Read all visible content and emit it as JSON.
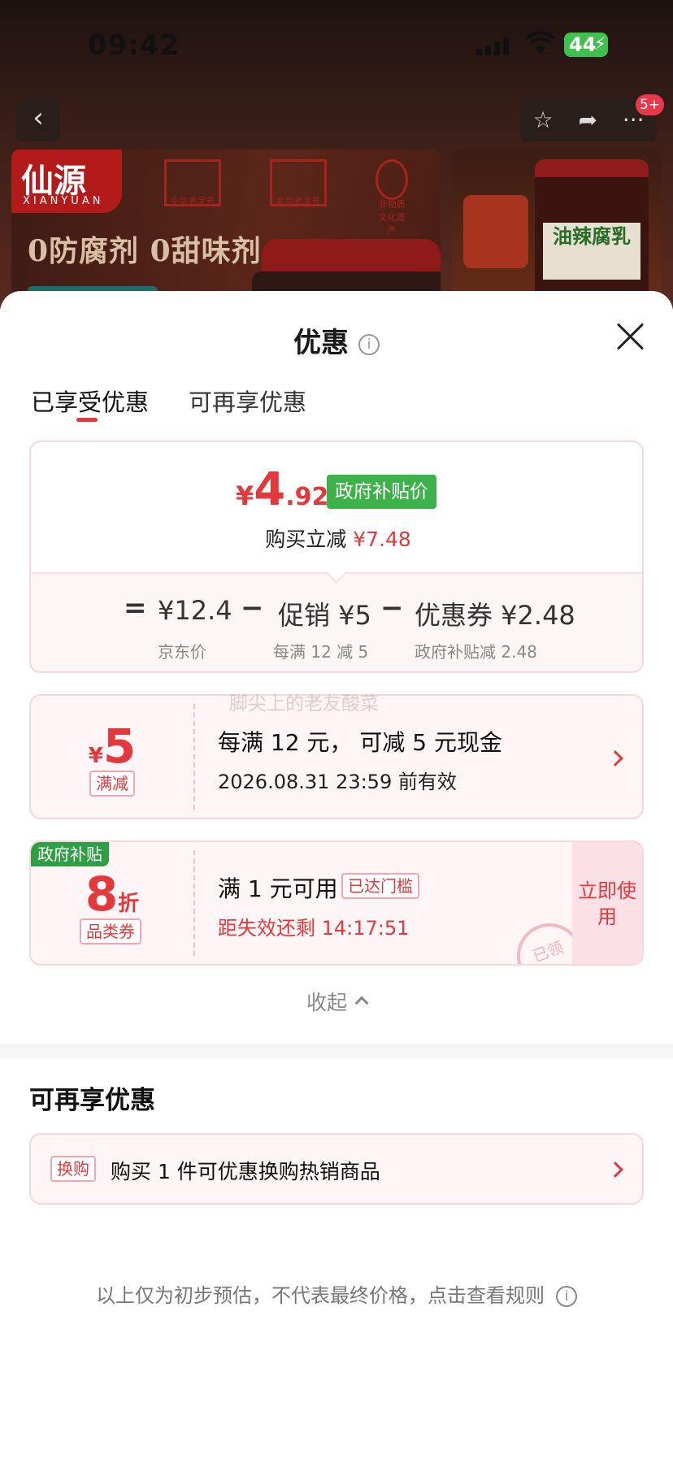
{
  "status_bar": {
    "time": "09:42",
    "battery": "44"
  },
  "background": {
    "brand_name": "仙源",
    "brand_sub": "XIANYUAN",
    "seal_labels": [
      "中华老字号",
      "北京老字号",
      "非物质文化遗产"
    ],
    "slogan": "0防腐剂 0甜味剂",
    "right_label": "油辣腐乳",
    "badge": "5+"
  },
  "sheet": {
    "title": "优惠",
    "tabs": [
      {
        "label": "已享受优惠"
      },
      {
        "label": "可再享优惠"
      }
    ]
  },
  "summary": {
    "currency": "¥",
    "final_big": "4",
    "final_small": ".92",
    "gov_tag": "政府补贴价",
    "instant_label": "购买立减",
    "instant_value": "¥7.48",
    "equals": "=",
    "minus": "−",
    "jd_price": "¥12.4",
    "jd_label": "京东价",
    "promo_value": "促销 ¥5",
    "promo_label": "每满 12 减 5",
    "coupon_value": "优惠券 ¥2.48",
    "coupon_label": "政府补贴减 2.48"
  },
  "coupon1": {
    "currency": "¥",
    "amount": "5",
    "tag": "满减",
    "title": "每满 12 元，  可减 5 元现金",
    "valid": "2026.08.31 23:59 前有效"
  },
  "watermark": "脚尖上的老友酸菜",
  "coupon2": {
    "ribbon": "政府补贴",
    "amount": "8",
    "unit": "折",
    "tag": "品类券",
    "title": "满 1 元可用",
    "reached": "已达门槛",
    "countdown": "距失效还剩 14:17:51",
    "use_btn": "立即使用",
    "stamp": "已领"
  },
  "collapse_label": "收起",
  "more_section": {
    "title": "可再享优惠",
    "tag": "换购",
    "text": "购买 1 件可优惠换购热销商品"
  },
  "disclaimer": "以上仅为初步预估，不代表最终价格，点击查看规则",
  "colors": {
    "accent": "#e4393c",
    "gov_green": "#3db14a"
  }
}
